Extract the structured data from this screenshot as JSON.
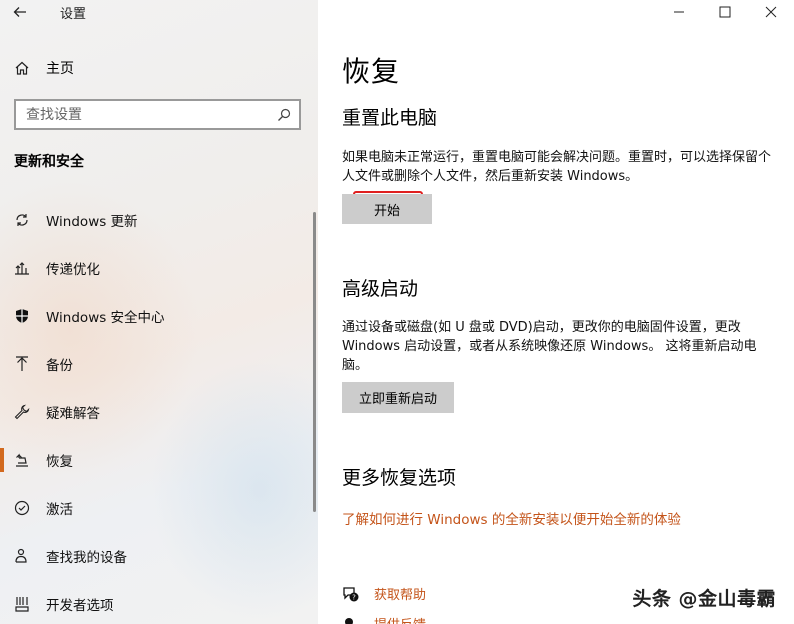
{
  "window": {
    "title": "设置",
    "controls": [
      "minimize",
      "maximize",
      "close"
    ]
  },
  "sidebar": {
    "home_label": "主页",
    "search_placeholder": "查找设置",
    "section_heading": "更新和安全",
    "items": [
      {
        "label": "Windows 更新",
        "icon": "sync-icon"
      },
      {
        "label": "传递优化",
        "icon": "delivery-optimization-icon"
      },
      {
        "label": "Windows 安全中心",
        "icon": "shield-icon"
      },
      {
        "label": "备份",
        "icon": "backup-arrow-icon"
      },
      {
        "label": "疑难解答",
        "icon": "wrench-icon"
      },
      {
        "label": "恢复",
        "icon": "recovery-icon",
        "selected": true
      },
      {
        "label": "激活",
        "icon": "check-circle-icon"
      },
      {
        "label": "查找我的设备",
        "icon": "person-location-icon"
      },
      {
        "label": "开发者选项",
        "icon": "developer-icon"
      }
    ]
  },
  "main": {
    "page_title": "恢复",
    "reset": {
      "title": "重置此电脑",
      "description": "如果电脑未正常运行，重置电脑可能会解决问题。重置时，可以选择保留个人文件或删除个人文件，然后重新安装 Windows。",
      "button": "开始"
    },
    "advanced": {
      "title": "高级启动",
      "description": "通过设备或磁盘(如 U 盘或 DVD)启动，更改你的电脑固件设置，更改 Windows 启动设置，或者从系统映像还原 Windows。 这将重新启动电脑。",
      "button": "立即重新启动"
    },
    "more": {
      "title": "更多恢复选项",
      "link": "了解如何进行 Windows 的全新安装以便开始全新的体验"
    },
    "help": {
      "get_help": "获取帮助",
      "feedback": "提供反馈"
    }
  },
  "watermark": "头条 @金山毒霸",
  "colors": {
    "accent": "#d2691e",
    "link": "#c4541a",
    "highlight_border": "#e02020"
  }
}
